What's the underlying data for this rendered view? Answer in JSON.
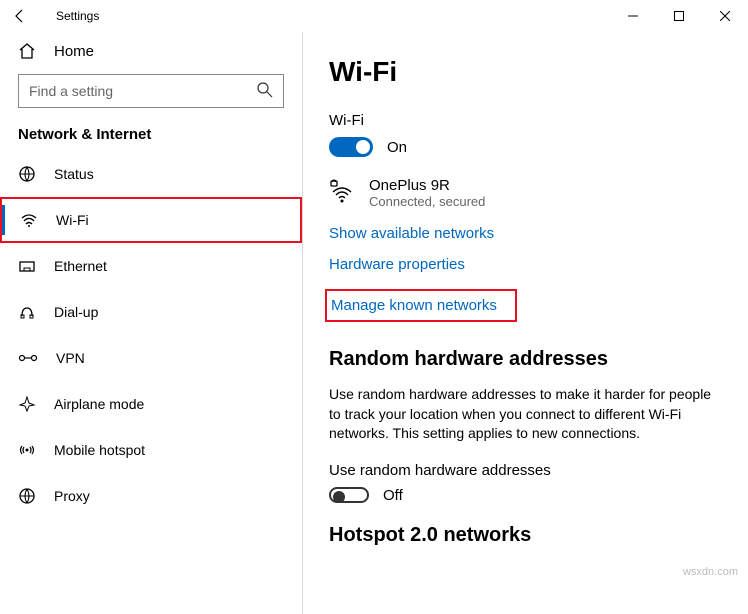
{
  "titlebar": {
    "app": "Settings"
  },
  "sidebar": {
    "home": "Home",
    "search_placeholder": "Find a setting",
    "section": "Network & Internet",
    "items": [
      {
        "label": "Status"
      },
      {
        "label": "Wi-Fi"
      },
      {
        "label": "Ethernet"
      },
      {
        "label": "Dial-up"
      },
      {
        "label": "VPN"
      },
      {
        "label": "Airplane mode"
      },
      {
        "label": "Mobile hotspot"
      },
      {
        "label": "Proxy"
      }
    ]
  },
  "content": {
    "title": "Wi-Fi",
    "wifi_label": "Wi-Fi",
    "wifi_state": "On",
    "network": {
      "name": "OnePlus 9R",
      "status": "Connected, secured"
    },
    "links": {
      "show_available": "Show available networks",
      "hardware_props": "Hardware properties",
      "manage_known": "Manage known networks"
    },
    "random_heading": "Random hardware addresses",
    "random_body": "Use random hardware addresses to make it harder for people to track your location when you connect to different Wi-Fi networks. This setting applies to new connections.",
    "random_toggle_label": "Use random hardware addresses",
    "random_toggle_state": "Off",
    "hotspot_heading": "Hotspot 2.0 networks"
  },
  "watermark": "wsxdn.com"
}
